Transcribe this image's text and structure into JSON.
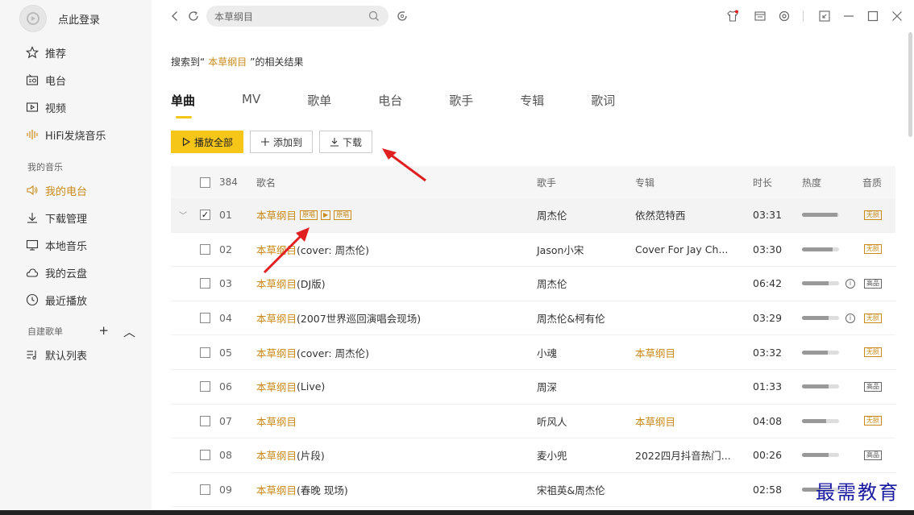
{
  "sidebar": {
    "login_text": "点此登录",
    "nav": [
      {
        "label": "推荐",
        "icon": "star-icon"
      },
      {
        "label": "电台",
        "icon": "radio-icon"
      },
      {
        "label": "视频",
        "icon": "video-icon"
      },
      {
        "label": "HiFi发烧音乐",
        "icon": "waveform-icon"
      }
    ],
    "my_music_title": "我的音乐",
    "my_music": [
      {
        "label": "我的电台",
        "icon": "speaker-icon"
      },
      {
        "label": "下载管理",
        "icon": "download-icon"
      },
      {
        "label": "本地音乐",
        "icon": "monitor-icon"
      },
      {
        "label": "我的云盘",
        "icon": "cloud-icon"
      },
      {
        "label": "最近播放",
        "icon": "clock-icon"
      }
    ],
    "playlists_title": "自建歌单",
    "playlist_add": "+",
    "playlist_collapse": "︿",
    "playlists": [
      {
        "label": "默认列表",
        "icon": "playlist-icon"
      }
    ]
  },
  "topbar": {
    "search_value": "本草纲目"
  },
  "main": {
    "result_prefix": "搜索到“",
    "result_keyword": "本草纲目",
    "result_suffix": "”的相关结果",
    "tabs": [
      "单曲",
      "MV",
      "歌单",
      "电台",
      "歌手",
      "专辑",
      "歌词"
    ],
    "actions": {
      "play_all": "播放全部",
      "add_to": "添加到",
      "download": "下载"
    },
    "table": {
      "count": "384",
      "headers": {
        "title": "歌名",
        "artist": "歌手",
        "album": "专辑",
        "duration": "时长",
        "heat": "热度",
        "quality": "音质"
      },
      "rows": [
        {
          "num": "01",
          "title": "本草纲目",
          "suffix": "",
          "badges": [
            "原唱",
            "▶",
            "原唱"
          ],
          "artist": "周杰伦",
          "album": "依然范特西",
          "album_link": false,
          "duration": "03:31",
          "heat": 0.95,
          "info": false,
          "quality": "无损",
          "quality_gold": true,
          "checked": true,
          "expand": true
        },
        {
          "num": "02",
          "title": "本草纲目",
          "suffix": " (cover: 周杰伦)",
          "badges": [],
          "artist": "Jason小宋",
          "album": "Cover For Jay Ch...",
          "album_link": false,
          "duration": "03:30",
          "heat": 0.82,
          "info": false,
          "quality": "无损",
          "quality_gold": true,
          "checked": false,
          "expand": false
        },
        {
          "num": "03",
          "title": "本草纲目",
          "suffix": " (DJ版)",
          "badges": [],
          "artist": "周杰伦",
          "album": "",
          "album_link": false,
          "duration": "06:42",
          "heat": 0.72,
          "info": true,
          "quality": "高品",
          "quality_gold": false,
          "checked": false,
          "expand": false
        },
        {
          "num": "04",
          "title": "本草纲目",
          "suffix": "(2007世界巡回演唱会现场)",
          "badges": [],
          "artist": "周杰伦&柯有伦",
          "album": "",
          "album_link": false,
          "duration": "03:29",
          "heat": 0.72,
          "info": true,
          "quality": "无损",
          "quality_gold": true,
          "checked": false,
          "expand": false
        },
        {
          "num": "05",
          "title": "本草纲目",
          "suffix": " (cover: 周杰伦)",
          "badges": [],
          "artist": "小魂",
          "album": "本草纲目",
          "album_link": true,
          "duration": "03:32",
          "heat": 0.7,
          "info": false,
          "quality": "无损",
          "quality_gold": true,
          "checked": false,
          "expand": false
        },
        {
          "num": "06",
          "title": "本草纲目",
          "suffix": "(Live)",
          "badges": [],
          "artist": "周深",
          "album": "",
          "album_link": false,
          "duration": "01:33",
          "heat": 0.72,
          "info": false,
          "quality": "高品",
          "quality_gold": false,
          "checked": false,
          "expand": false
        },
        {
          "num": "07",
          "title": "本草纲目",
          "suffix": "",
          "badges": [],
          "artist": "听风人",
          "album": "本草纲目",
          "album_link": true,
          "duration": "04:08",
          "heat": 0.66,
          "info": false,
          "quality": "无损",
          "quality_gold": true,
          "checked": false,
          "expand": false
        },
        {
          "num": "08",
          "title": "本草纲目",
          "suffix": "(片段)",
          "badges": [],
          "artist": "麦小兜",
          "album": "2022四月抖音热门...",
          "album_link": false,
          "duration": "00:26",
          "heat": 0.72,
          "info": false,
          "quality": "高品",
          "quality_gold": false,
          "checked": false,
          "expand": false
        },
        {
          "num": "09",
          "title": "本草纲目",
          "suffix": " (春晚 现场)",
          "badges": [],
          "artist": "宋祖英&周杰伦",
          "album": "",
          "album_link": false,
          "duration": "02:58",
          "heat": 0.5,
          "info": false,
          "quality": "",
          "quality_gold": false,
          "checked": false,
          "expand": false
        }
      ]
    }
  },
  "watermark": "最需教育",
  "colors": {
    "accent": "#f5c518",
    "link": "#c98a1a",
    "arrow": "#e02020"
  }
}
